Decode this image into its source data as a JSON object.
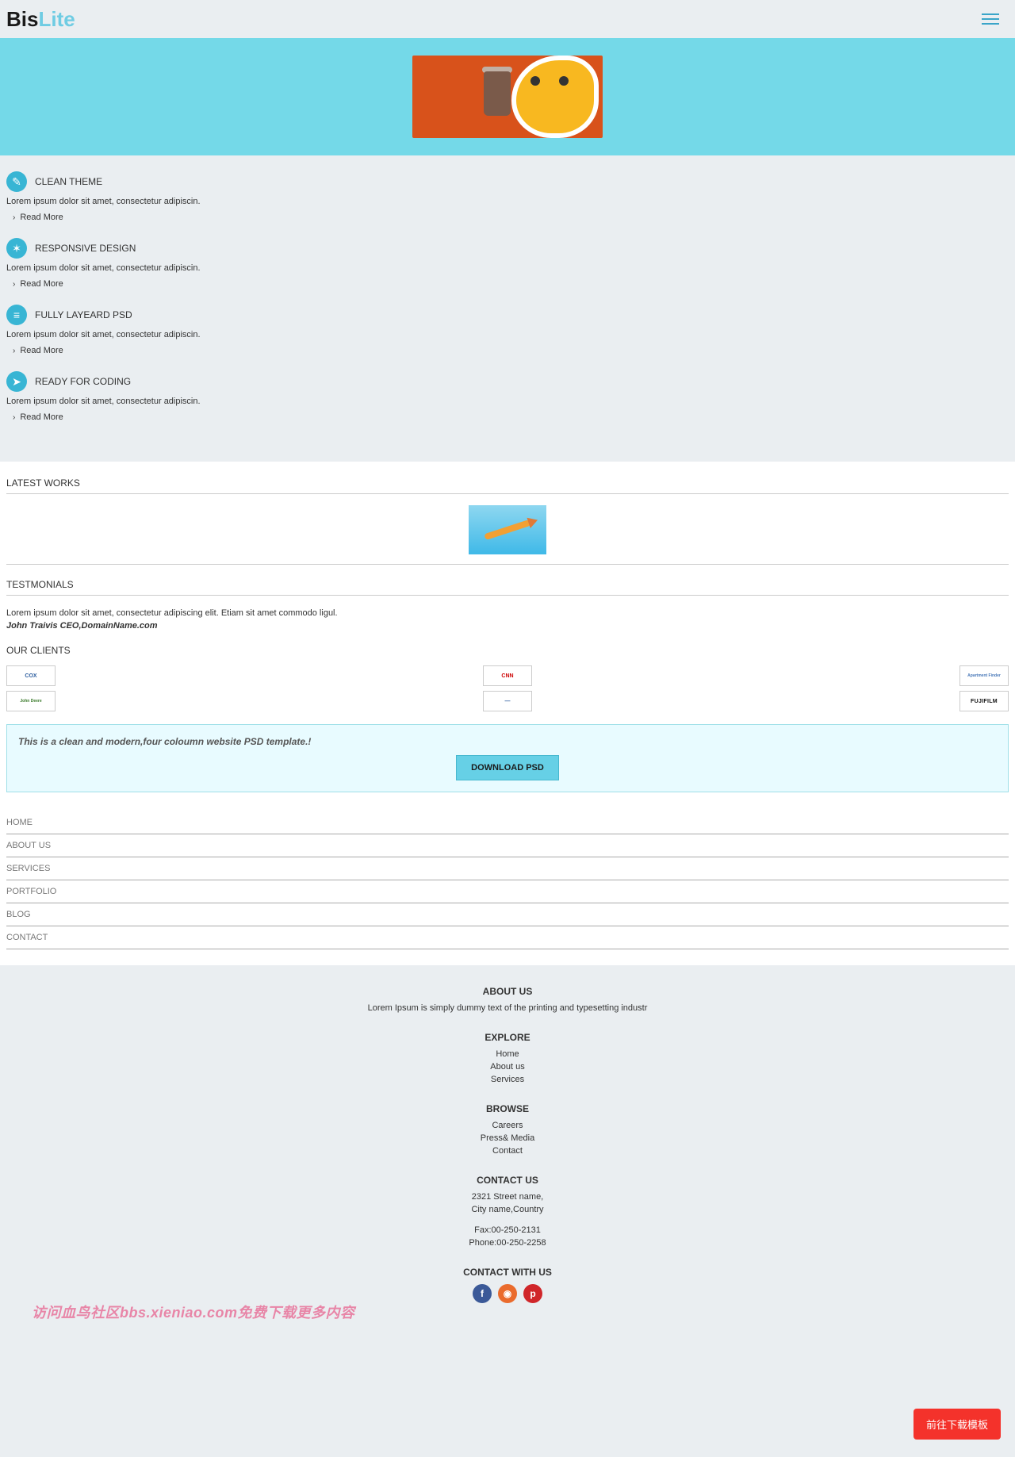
{
  "brand": {
    "part1": "Bis",
    "part2": "Lite"
  },
  "features": [
    {
      "title": "CLEAN THEME",
      "desc": "Lorem ipsum dolor sit amet, consectetur adipiscin.",
      "link": "Read More"
    },
    {
      "title": "RESPONSIVE DESIGN",
      "desc": "Lorem ipsum dolor sit amet, consectetur adipiscin.",
      "link": "Read More"
    },
    {
      "title": "FULLY LAYEARD PSD",
      "desc": "Lorem ipsum dolor sit amet, consectetur adipiscin.",
      "link": "Read More"
    },
    {
      "title": "READY FOR CODING",
      "desc": "Lorem ipsum dolor sit amet, consectetur adipiscin.",
      "link": "Read More"
    }
  ],
  "sections": {
    "works": "LATEST WORKS",
    "testimonials": "TESTMONIALS",
    "clients": "OUR CLIENTS"
  },
  "testimonial": {
    "text": "Lorem ipsum dolor sit amet, consectetur adipiscing elit. Etiam sit amet commodo ligul.",
    "author": "John  Traivis  CEO,DomainName.com"
  },
  "clients": [
    "COX",
    "CNN",
    "Apartment Finder",
    "John Deere",
    "—",
    "FUJIFILM"
  ],
  "download": {
    "text": "This is a clean and modern,four coloumn website PSD template.!",
    "button": "DOWNLOAD PSD"
  },
  "nav": [
    "HOME",
    "ABOUT US",
    "SERVICES",
    "PORTFOLIO",
    "BLOG",
    "CONTACT"
  ],
  "footer": {
    "about": {
      "title": "ABOUT US",
      "text": "Lorem Ipsum is simply dummy text of the printing and typesetting industr"
    },
    "explore": {
      "title": "EXPLORE",
      "links": [
        "Home",
        "About us",
        "Services"
      ]
    },
    "browse": {
      "title": "BROWSE",
      "links": [
        "Careers",
        "Press& Media",
        "Contact"
      ]
    },
    "contact": {
      "title": "CONTACT US",
      "addr1": "2321 Street name,",
      "addr2": "City name,Country",
      "fax": "Fax:00-250-2131",
      "phone": "Phone:00-250-2258"
    },
    "social": {
      "title": "CONTACT WITH US"
    }
  },
  "watermark": "访问血鸟社区bbs.xieniao.com免费下载更多内容",
  "floatbtn": "前往下载模板"
}
